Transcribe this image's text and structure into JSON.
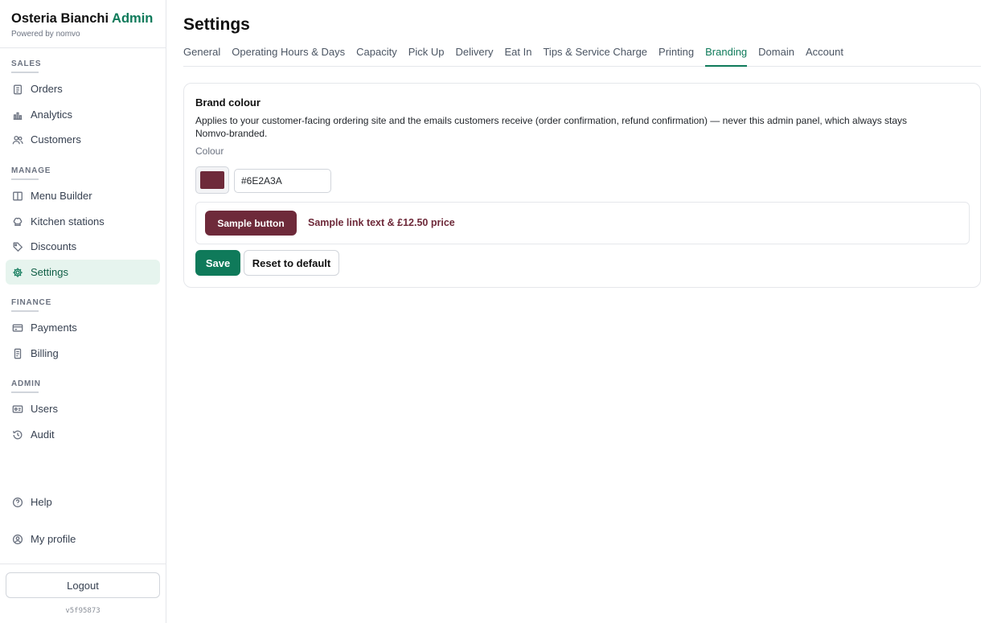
{
  "brand": {
    "name": "Osteria Bianchi",
    "badge": "Admin",
    "powered_by": "Powered by nomvo"
  },
  "sidebar": {
    "sections": [
      {
        "label": "SALES",
        "items": [
          {
            "label": "Orders",
            "icon": "clipboard-icon"
          },
          {
            "label": "Analytics",
            "icon": "bar-chart-icon"
          },
          {
            "label": "Customers",
            "icon": "users-icon"
          }
        ]
      },
      {
        "label": "MANAGE",
        "items": [
          {
            "label": "Menu Builder",
            "icon": "book-icon"
          },
          {
            "label": "Kitchen stations",
            "icon": "chef-hat-icon"
          },
          {
            "label": "Discounts",
            "icon": "tag-icon"
          },
          {
            "label": "Settings",
            "icon": "gear-icon",
            "active": true
          }
        ]
      },
      {
        "label": "FINANCE",
        "items": [
          {
            "label": "Payments",
            "icon": "credit-card-icon"
          },
          {
            "label": "Billing",
            "icon": "receipt-icon"
          }
        ]
      },
      {
        "label": "ADMIN",
        "items": [
          {
            "label": "Users",
            "icon": "id-card-icon"
          },
          {
            "label": "Audit",
            "icon": "history-icon"
          }
        ]
      }
    ],
    "footer_items": [
      {
        "label": "Help",
        "icon": "help-circle-icon"
      },
      {
        "label": "My profile",
        "icon": "user-circle-icon"
      }
    ],
    "logout_label": "Logout",
    "version": "v5f95873"
  },
  "page": {
    "title": "Settings",
    "tabs": [
      {
        "label": "General"
      },
      {
        "label": "Operating Hours & Days"
      },
      {
        "label": "Capacity"
      },
      {
        "label": "Pick Up"
      },
      {
        "label": "Delivery"
      },
      {
        "label": "Eat In"
      },
      {
        "label": "Tips & Service Charge"
      },
      {
        "label": "Printing"
      },
      {
        "label": "Branding",
        "active": true
      },
      {
        "label": "Domain"
      },
      {
        "label": "Account"
      }
    ]
  },
  "branding": {
    "card_title": "Brand colour",
    "description": "Applies to your customer-facing ordering site and the emails customers receive (order confirmation, refund confirmation) — never this admin panel, which always stays Nomvo-branded.",
    "colour_label": "Colour",
    "colour_value": "#6E2A3A",
    "sample_button_label": "Sample button",
    "sample_link_text": "Sample link text & £12.50 price",
    "save_label": "Save",
    "reset_label": "Reset to default"
  },
  "colors": {
    "accent": "#0f7a5a",
    "brand_colour": "#6E2A3A",
    "active_nav_bg": "#e6f4ee"
  }
}
